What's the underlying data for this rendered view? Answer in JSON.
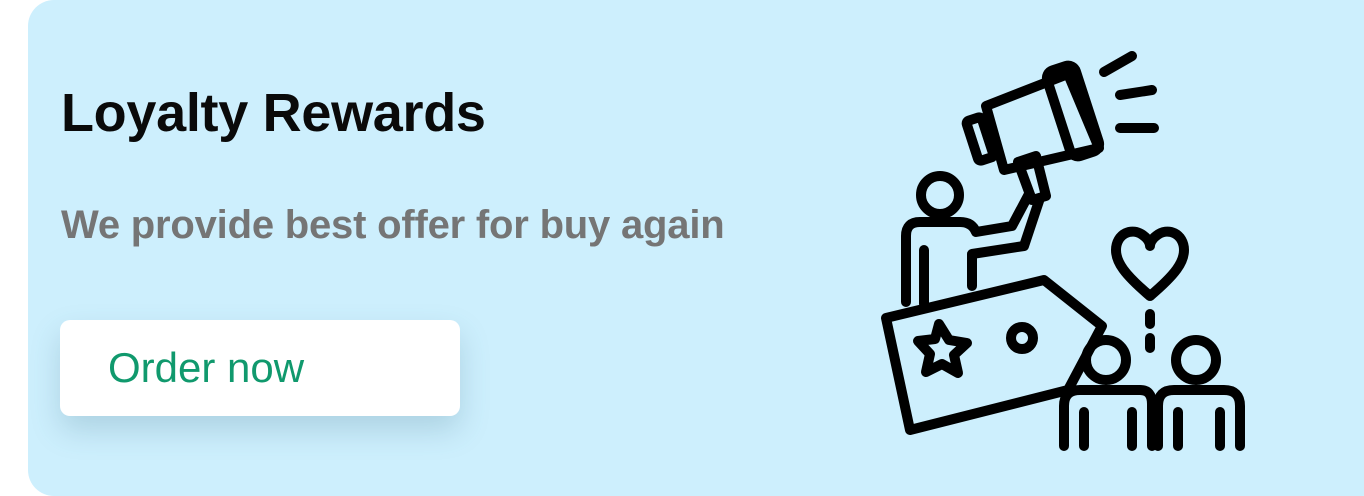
{
  "card": {
    "title": "Loyalty Rewards",
    "subtitle": "We provide best offer for buy again",
    "cta_label": "Order now"
  },
  "colors": {
    "card_background": "#cdeffd",
    "title": "#0a0a0a",
    "subtitle": "#757575",
    "button_background": "#ffffff",
    "button_text": "#10996d",
    "illustration_stroke": "#000000"
  },
  "illustration": {
    "icons": [
      "megaphone-icon",
      "promoter-person-icon",
      "star-tag-icon",
      "heart-icon",
      "customers-icon"
    ]
  }
}
